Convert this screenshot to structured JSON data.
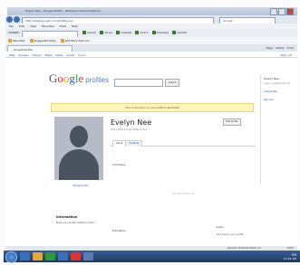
{
  "browser": {
    "title": "Evelyn Nee - Google Profile - Windows Internet Explorer",
    "address": "http://www.google.com/profiles/me",
    "search_placeholder": "Google",
    "menu": [
      "File",
      "Edit",
      "View",
      "Favorites",
      "Tools",
      "Help"
    ],
    "google_toolbar_label": "Google",
    "toolbar_items": [
      "Search",
      "Share",
      "Sidewiki",
      "Check",
      "Translate",
      "AutoFill"
    ],
    "favorites": [
      "Favorites",
      "Suggested Sites",
      "Get More Add-ons"
    ],
    "tab_title": "Google Profile",
    "tab_tools": [
      "Page",
      "Safety",
      "Tools"
    ],
    "status_zone": "Internet | Protected Mode: On",
    "zoom": "100%"
  },
  "page": {
    "gbar_links": [
      "Web",
      "Images",
      "Videos",
      "Maps",
      "News",
      "Gmail",
      "more"
    ],
    "gbar_right": "Sign out",
    "logo_letters": [
      "G",
      "o",
      "o",
      "g",
      "l",
      "e"
    ],
    "logo_sub": "profiles",
    "search_button": "Search",
    "banner": "Click on the pencil on your profile to get started",
    "name": "Evelyn Nee",
    "tagline": "Your profile is only visible to you",
    "edit_button": "Edit profile",
    "tabs": [
      "About",
      "Contacts"
    ],
    "avatar_caption": "Change photo",
    "section_label": "Summary",
    "empty_note": "No information yet",
    "info_head": "Information",
    "info_text": "Make your profile visible to others",
    "bottom_label": "Education",
    "bottom_right_label": "Links",
    "bottom_right_text": "Add links to your profile",
    "side_title": "Evelyn Nee",
    "side_line": "evelyn.nee@gmail.com",
    "side_link1": "View profile",
    "side_link2": "Sign out"
  },
  "taskbar": {
    "tray": "EN",
    "time": "10:24 AM",
    "icon_colors": [
      "#3a6fc0",
      "#e8a33a",
      "#2a9a3a",
      "#3a6fc0",
      "#d33",
      "#5a7bb5"
    ]
  }
}
